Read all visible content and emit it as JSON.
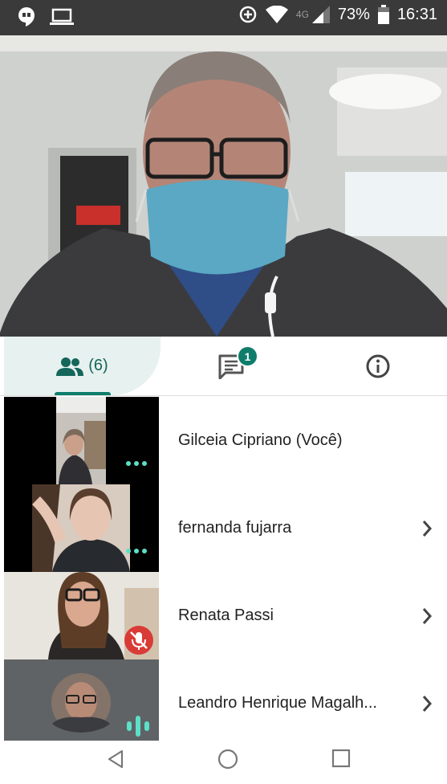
{
  "status_bar": {
    "battery": "73%",
    "time": "16:31",
    "network": "4G",
    "icons": [
      "hangouts-icon",
      "laptop-icon",
      "data-saver-icon",
      "wifi-icon",
      "signal-icon",
      "battery-icon"
    ]
  },
  "tabs": {
    "people_count": "(6)",
    "chat_badge": "1",
    "active": "people"
  },
  "participants": [
    {
      "name": "Gilceia Cipriano (Você)",
      "has_chevron": false,
      "indicator": "more-dots"
    },
    {
      "name": "fernanda fujarra",
      "has_chevron": true,
      "indicator": "more-dots"
    },
    {
      "name": "Renata Passi",
      "has_chevron": true,
      "indicator": "muted-mic"
    },
    {
      "name": "Leandro Henrique Magalh...",
      "has_chevron": true,
      "indicator": "audio-level"
    }
  ],
  "colors": {
    "accent": "#0f7d6b",
    "tab_active_bg": "#e7f1ef",
    "muted_red": "#d93b36",
    "dots": "#5ce0c8"
  }
}
